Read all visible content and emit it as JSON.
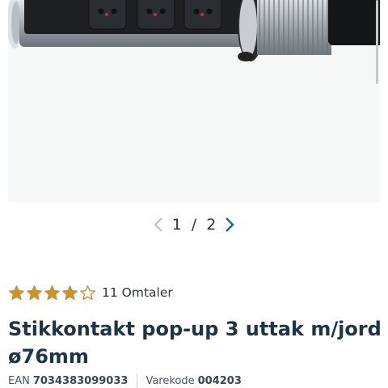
{
  "gallery": {
    "image_alt": "Stikkontakt pop-up product photo",
    "current_page": "1",
    "separator": "/",
    "total_pages": "2"
  },
  "rating": {
    "stars_filled": 4,
    "stars_total": 5,
    "review_count_label": "11 Omtaler",
    "star_color": "#c9942d"
  },
  "product": {
    "title": "Stikkontakt pop-up 3 uttak m/jord ø76mm",
    "ean_label": "EAN",
    "ean_value": "7034383099033",
    "sku_label": "Varekode",
    "sku_value": "004203"
  },
  "colors": {
    "accent": "#0e6e78",
    "text": "#1f3444"
  }
}
